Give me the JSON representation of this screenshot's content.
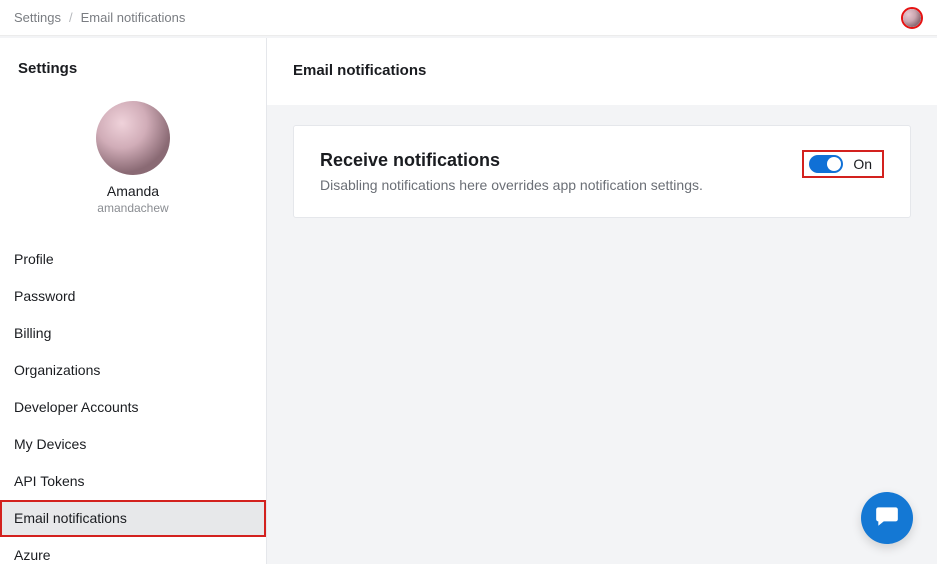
{
  "breadcrumb": {
    "root": "Settings",
    "separator": "/",
    "current": "Email notifications"
  },
  "sidebar": {
    "title": "Settings",
    "user": {
      "display_name": "Amanda",
      "username": "amandachew"
    },
    "items": [
      {
        "label": "Profile",
        "active": false
      },
      {
        "label": "Password",
        "active": false
      },
      {
        "label": "Billing",
        "active": false
      },
      {
        "label": "Organizations",
        "active": false
      },
      {
        "label": "Developer Accounts",
        "active": false
      },
      {
        "label": "My Devices",
        "active": false
      },
      {
        "label": "API Tokens",
        "active": false
      },
      {
        "label": "Email notifications",
        "active": true
      },
      {
        "label": "Azure",
        "active": false
      }
    ]
  },
  "content": {
    "page_title": "Email notifications",
    "card": {
      "title": "Receive notifications",
      "description": "Disabling notifications here overrides app notification settings.",
      "toggle_state": "On",
      "toggle_on": true
    }
  }
}
